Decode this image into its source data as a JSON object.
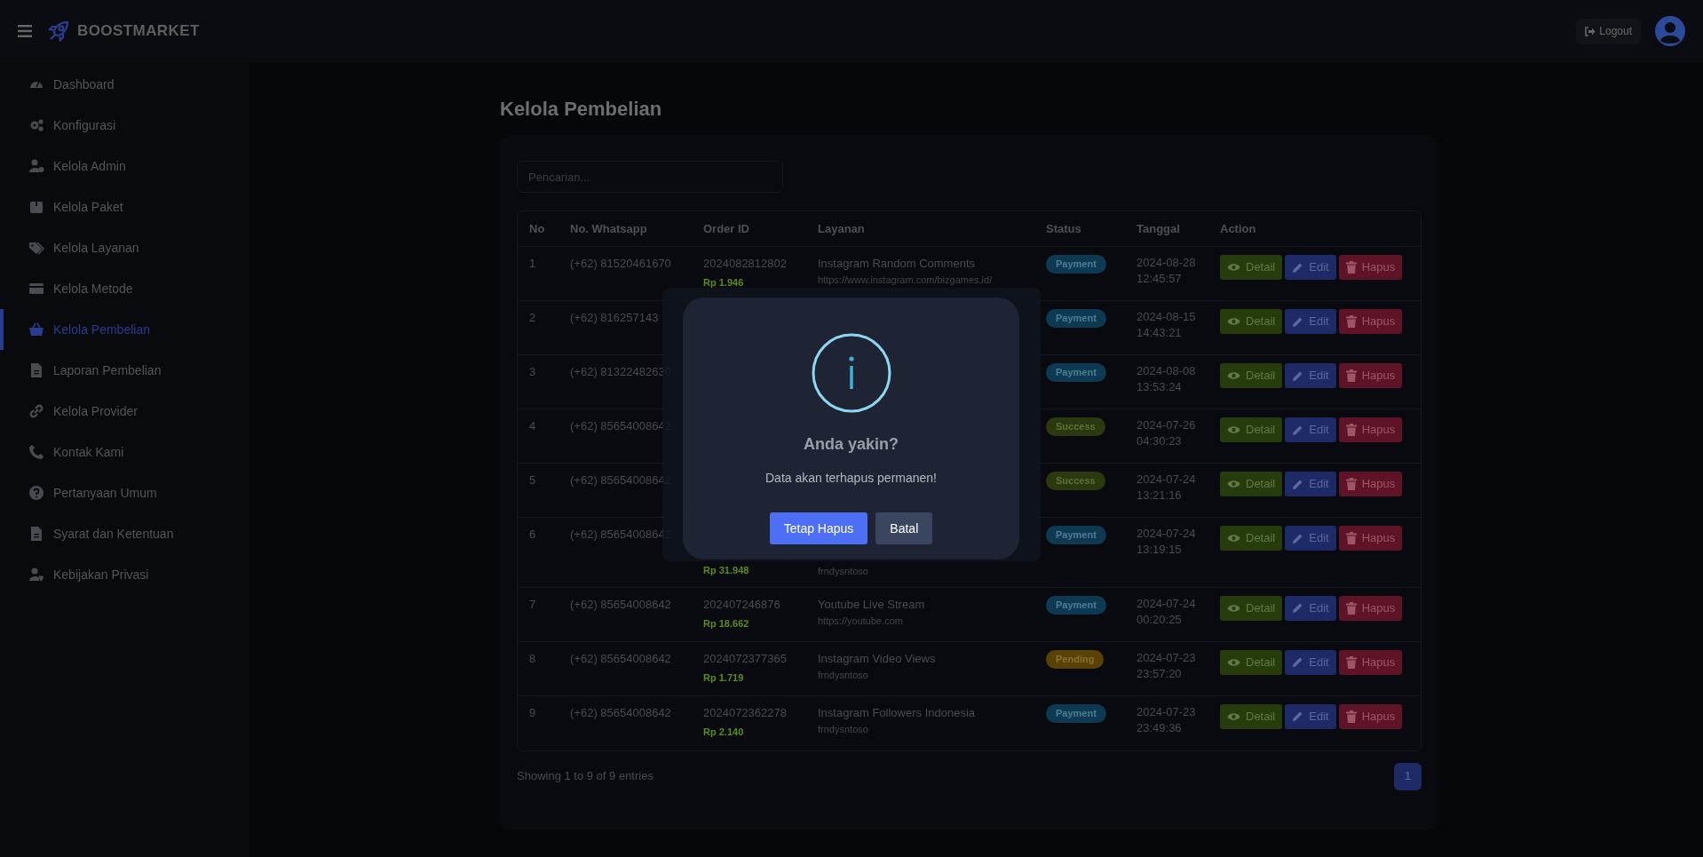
{
  "header": {
    "brand": "BOOSTMARKET",
    "logout": "Logout"
  },
  "sidebar": {
    "items": [
      {
        "label": "Dashboard",
        "selected": false
      },
      {
        "label": "Konfigurasi",
        "selected": false
      },
      {
        "label": "Kelola Admin",
        "selected": false
      },
      {
        "label": "Kelola Paket",
        "selected": false
      },
      {
        "label": "Kelola Layanan",
        "selected": false
      },
      {
        "label": "Kelola Metode",
        "selected": false
      },
      {
        "label": "Kelola Pembelian",
        "selected": true
      },
      {
        "label": "Laporan Pembelian",
        "selected": false
      },
      {
        "label": "Kelola Provider",
        "selected": false
      },
      {
        "label": "Kontak Kami",
        "selected": false
      },
      {
        "label": "Pertanyaan Umum",
        "selected": false
      },
      {
        "label": "Syarat dan Ketentuan",
        "selected": false
      },
      {
        "label": "Kebijakan Privasi",
        "selected": false
      }
    ]
  },
  "page": {
    "title": "Kelola Pembelian",
    "search": {
      "placeholder": "Pencarian..."
    }
  },
  "table": {
    "columns": [
      "No",
      "No. Whatsapp",
      "Order ID",
      "Layanan",
      "Status",
      "Tanggal",
      "Action"
    ],
    "rows": [
      {
        "no": "1",
        "phone": "(+62) 81520461670",
        "order_id": "2024082812802",
        "price": "Rp 1.946",
        "service": "Instagram Random Comments",
        "target": "https://www.instagram.com/bizgames.id/",
        "status": {
          "label": "Payment",
          "kind": "payment"
        },
        "date": "2024-08-28 12:45:57",
        "actions": [
          {
            "kind": "detail",
            "label": "Detail"
          },
          {
            "kind": "edit",
            "label": "Edit"
          },
          {
            "kind": "delete",
            "label": "Hapus"
          }
        ]
      },
      {
        "no": "2",
        "phone": "(+62) 816257143",
        "status": {
          "label": "Payment",
          "kind": "payment"
        },
        "date": "2024-08-15 14:43:21",
        "actions": [
          {
            "kind": "detail",
            "label": "Detail"
          },
          {
            "kind": "edit",
            "label": "Edit"
          },
          {
            "kind": "delete",
            "label": "Hapus"
          }
        ]
      },
      {
        "no": "3",
        "phone": "(+62) 81322482630",
        "status": {
          "label": "Payment",
          "kind": "payment"
        },
        "date": "2024-08-08 13:53:24",
        "actions": [
          {
            "kind": "detail",
            "label": "Detail"
          },
          {
            "kind": "edit",
            "label": "Edit"
          },
          {
            "kind": "delete",
            "label": "Hapus"
          }
        ]
      },
      {
        "no": "4",
        "phone": "(+62) 85654008642",
        "status": {
          "label": "Success",
          "kind": "success"
        },
        "date": "2024-07-26 04:30:23",
        "actions": [
          {
            "kind": "detail",
            "label": "Detail"
          },
          {
            "kind": "edit",
            "label": "Edit"
          },
          {
            "kind": "delete",
            "label": "Hapus"
          }
        ]
      },
      {
        "no": "5",
        "phone": "(+62) 85654008642",
        "status": {
          "label": "Success",
          "kind": "success"
        },
        "date": "2024-07-24 13:21:16",
        "actions": [
          {
            "kind": "detail",
            "label": "Detail"
          },
          {
            "kind": "edit",
            "label": "Edit"
          },
          {
            "kind": "delete",
            "label": "Hapus"
          }
        ]
      },
      {
        "no": "6",
        "phone": "(+62) 85654008642",
        "price": "Rp 31.948",
        "target": "frndysntoso",
        "status": {
          "label": "Payment",
          "kind": "payment"
        },
        "date": "2024-07-24 13:19:15",
        "actions": [
          {
            "kind": "detail",
            "label": "Detail"
          },
          {
            "kind": "edit",
            "label": "Edit"
          },
          {
            "kind": "delete",
            "label": "Hapus"
          }
        ]
      },
      {
        "no": "7",
        "phone": "(+62) 85654008642",
        "order_id": "202407246876",
        "price": "Rp 18.662",
        "service": "Youtube Live Stream",
        "target": "https://youtube.com",
        "status": {
          "label": "Payment",
          "kind": "payment"
        },
        "date": "2024-07-24 00:20:25",
        "actions": [
          {
            "kind": "detail",
            "label": "Detail"
          },
          {
            "kind": "edit",
            "label": "Edit"
          },
          {
            "kind": "delete",
            "label": "Hapus"
          }
        ]
      },
      {
        "no": "8",
        "phone": "(+62) 85654008642",
        "order_id": "2024072377365",
        "price": "Rp 1.719",
        "service": "Instagram Video Views",
        "target": "frndysntoso",
        "status": {
          "label": "Pending",
          "kind": "pending"
        },
        "date": "2024-07-23 23:57:20",
        "actions": [
          {
            "kind": "detail",
            "label": "Detail"
          },
          {
            "kind": "edit",
            "label": "Edit"
          },
          {
            "kind": "delete",
            "label": "Hapus"
          }
        ]
      },
      {
        "no": "9",
        "phone": "(+62) 85654008642",
        "order_id": "2024072362278",
        "price": "Rp 2.140",
        "service": "Instagram Followers Indonesia",
        "target": "frndysntoso",
        "status": {
          "label": "Payment",
          "kind": "payment"
        },
        "date": "2024-07-23 23:49:36",
        "actions": [
          {
            "kind": "detail",
            "label": "Detail"
          },
          {
            "kind": "edit",
            "label": "Edit"
          },
          {
            "kind": "delete",
            "label": "Hapus"
          }
        ]
      }
    ]
  },
  "footer": {
    "info": "Showing 1 to 9 of 9 entries",
    "pages": [
      {
        "label": "1",
        "selected": true
      }
    ]
  },
  "dialog": {
    "title": "Anda yakin?",
    "message": "Data akan terhapus permanen!",
    "buttons": [
      {
        "kind": "confirm",
        "label": "Tetap Hapus"
      },
      {
        "kind": "cancel",
        "label": "Batal"
      }
    ]
  }
}
